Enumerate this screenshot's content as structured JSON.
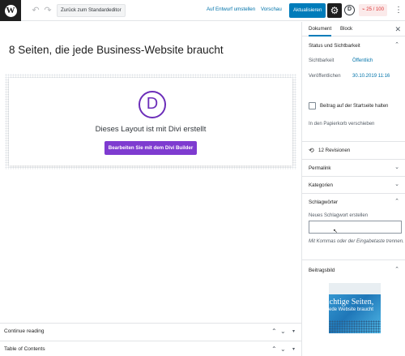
{
  "topbar": {
    "logo": "W",
    "undo_icon": "undo-icon",
    "redo_icon": "redo-icon",
    "back_label": "Zurück zum Standardeditor",
    "save_draft_label": "Auf Entwurf umstellen",
    "preview_label": "Vorschau",
    "publish_label": "Aktualisieren",
    "gear_icon": "⚙",
    "divi_icon": "D",
    "score_label": "25 / 100",
    "more_icon": "⋮"
  },
  "editor": {
    "post_title": "8 Seiten, die jede Business-Website braucht",
    "divi_logo": "D",
    "divi_text": "Dieses Layout ist mit Divi erstellt",
    "divi_button": "Bearbeiten Sie mit dem Divi Builder"
  },
  "meta_boxes": [
    {
      "label": "Continue reading"
    },
    {
      "label": "Table of Contents"
    }
  ],
  "sidebar": {
    "tab_document": "Dokument",
    "tab_block": "Block",
    "status_heading": "Status und Sichtbarkeit",
    "visibility_label": "Sichtbarkeit",
    "visibility_value": "Öffentlich",
    "publish_label": "Veröffentlichen",
    "publish_value": "30.10.2019 11:16",
    "sticky_label": "Beitrag auf der Startseite halten",
    "trash_label": "In den Papierkorb verschieben",
    "revisions_label": "12 Revisionen",
    "permalink_label": "Permalink",
    "categories_label": "Kategorien",
    "tags_heading": "Schlagwörter",
    "new_tag_label": "Neues Schlagwort erstellen",
    "tags_help": "Mit Kommas oder der Eingabetaste trennen.",
    "featured_image_heading": "Beitragsbild",
    "featured_image_line1": "ichtige Seiten,",
    "featured_image_line2": "ede Website braucht"
  },
  "colors": {
    "accent": "#007cba",
    "divi_purple": "#7e3bd0",
    "score_red": "#dc3232"
  }
}
